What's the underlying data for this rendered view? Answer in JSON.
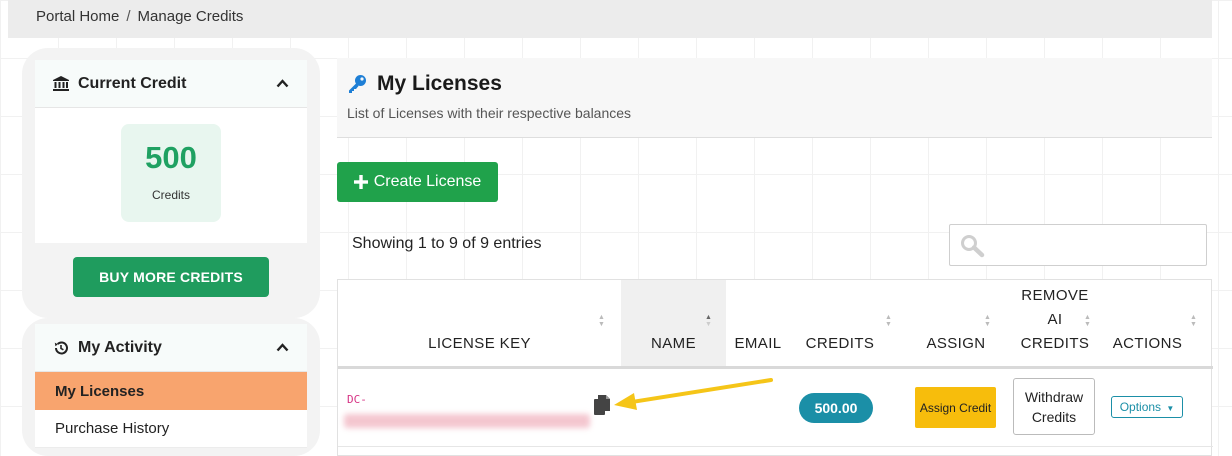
{
  "breadcrumb": {
    "home": "Portal Home",
    "separator": "/",
    "current": "Manage Credits"
  },
  "sidebar": {
    "credit_card": {
      "title": "Current Credit",
      "icon": "bank-icon",
      "value": "500",
      "unit": "Credits",
      "button": "BUY MORE CREDITS"
    },
    "activity_card": {
      "title": "My Activity",
      "icon": "history-icon",
      "items": [
        {
          "label": "My Licenses",
          "active": true
        },
        {
          "label": "Purchase History",
          "active": false
        }
      ]
    }
  },
  "main": {
    "title": "My Licenses",
    "title_icon": "key-icon",
    "subtitle": "List of Licenses with their respective balances",
    "create_button": "Create License",
    "showing": "Showing 1 to 9 of 9 entries",
    "search_icon": "search-icon",
    "table": {
      "columns": [
        "LICENSE KEY",
        "NAME",
        "EMAIL",
        "CREDITS",
        "ASSIGN",
        "REMOVE AI CREDITS",
        "ACTIONS"
      ],
      "rows": [
        {
          "license_key_prefix": "DC-",
          "name": "",
          "email": "",
          "credits": "500.00",
          "assign": "Assign Credit",
          "withdraw": "Withdraw Credits",
          "options": "Options"
        }
      ]
    }
  },
  "colors": {
    "brand_green": "#1f9c5e",
    "create_green": "#20a24b",
    "credit_badge": "#1b8fa7",
    "assign_yellow": "#f7bd0c",
    "active_menu": "#f8a46e",
    "annotation_arrow": "#f5c518"
  }
}
